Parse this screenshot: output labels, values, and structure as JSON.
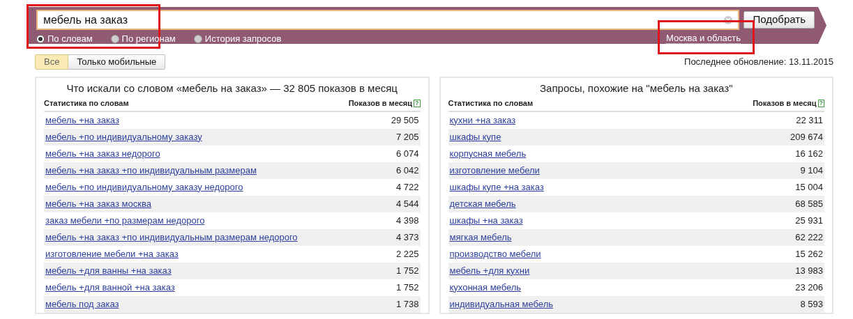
{
  "search": {
    "value": "мебель на заказ",
    "button": "Подобрать",
    "modes": [
      {
        "label": "По словам",
        "selected": true
      },
      {
        "label": "По регионам",
        "selected": false
      },
      {
        "label": "История запросов",
        "selected": false
      }
    ],
    "region": "Москва и область"
  },
  "filters": [
    {
      "label": "Все",
      "selected": true
    },
    {
      "label": "Только мобильные",
      "selected": false
    }
  ],
  "last_update": "Последнее обновление: 13.11.2015",
  "panels": [
    {
      "title": "Что искали со словом «мебель на заказ» — 32 805 показов в месяц",
      "columns": [
        "Статистика по словам",
        "Показов в месяц"
      ],
      "help": "?",
      "rows": [
        {
          "phrase": "мебель +на заказ",
          "count": "29 505"
        },
        {
          "phrase": "мебель +по индивидуальному заказу",
          "count": "7 205"
        },
        {
          "phrase": "мебель +на заказ недорого",
          "count": "6 074"
        },
        {
          "phrase": "мебель +на заказ +по индивидуальным размерам",
          "count": "6 042"
        },
        {
          "phrase": "мебель +по индивидуальному заказу недорого",
          "count": "4 722"
        },
        {
          "phrase": "мебель +на заказ москва",
          "count": "4 544"
        },
        {
          "phrase": "заказ мебели +по размерам недорого",
          "count": "4 398"
        },
        {
          "phrase": "мебель +на заказ +по индивидуальным размерам недорого",
          "count": "4 373"
        },
        {
          "phrase": "изготовление мебели +на заказ",
          "count": "2 225"
        },
        {
          "phrase": "мебель +для ванны +на заказ",
          "count": "1 752"
        },
        {
          "phrase": "мебель +для ванной +на заказ",
          "count": "1 752"
        },
        {
          "phrase": "мебель под заказ",
          "count": "1 738"
        }
      ]
    },
    {
      "title": "Запросы, похожие на \"мебель на заказ\"",
      "columns": [
        "Статистика по словам",
        "Показов в месяц"
      ],
      "help": "?",
      "rows": [
        {
          "phrase": "кухни +на заказ",
          "count": "22 311"
        },
        {
          "phrase": "шкафы купе",
          "count": "209 674"
        },
        {
          "phrase": "корпусная мебель",
          "count": "16 162"
        },
        {
          "phrase": "изготовление мебели",
          "count": "9 104"
        },
        {
          "phrase": "шкафы купе +на заказ",
          "count": "15 004"
        },
        {
          "phrase": "детская мебель",
          "count": "68 585"
        },
        {
          "phrase": "шкафы +на заказ",
          "count": "25 931"
        },
        {
          "phrase": "мягкая мебель",
          "count": "62 222"
        },
        {
          "phrase": "производство мебели",
          "count": "15 262"
        },
        {
          "phrase": "мебель +для кухни",
          "count": "13 983"
        },
        {
          "phrase": "кухонная мебель",
          "count": "23 206"
        },
        {
          "phrase": "индивидуальная мебель",
          "count": "8 593"
        }
      ]
    }
  ]
}
